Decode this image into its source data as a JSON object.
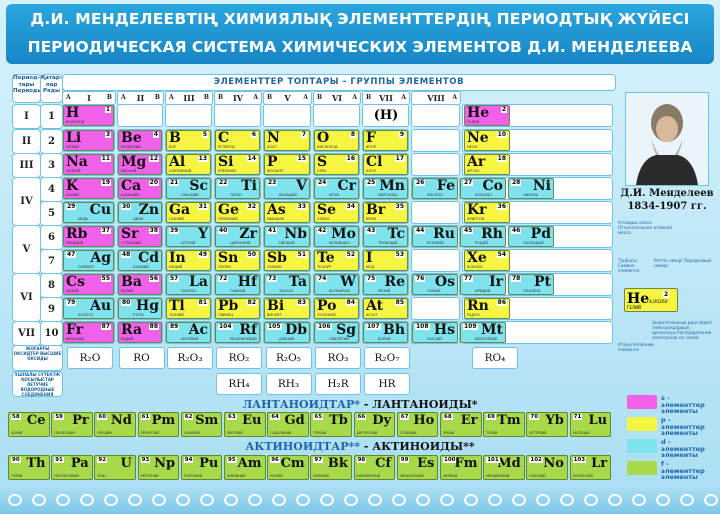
{
  "title": {
    "kz": "Д.И. МЕНДЕЛЕЕВТІҢ ХИМИЯЛЫҚ ЭЛЕМЕНТТЕРДІҢ ПЕРИОДТЫҚ ЖҮЙЕСІ",
    "ru": "ПЕРИОДИЧЕСКАЯ СИСТЕМА ХИМИЧЕСКИХ ЭЛЕМЕНТОВ Д.И. МЕНДЕЛЕЕВА"
  },
  "headers": {
    "periods": "Период-тары Периоды",
    "rows": "Қатар-лар Ряды",
    "groups": "ЭЛЕМЕНТТЕР ТОПТАРЫ  -  ГРУППЫ ЭЛЕМЕНТОВ",
    "oxides": "ЖОҒАРҒЫ ОКСИДТЕР ВЫСШИЕ ОКСИДЫ",
    "hydrides": "ҰШПАЛЫ СУТЕКТІК ҚОСЫЛЫСТАР ЛЕТУЧИЕ ВОДОРОДНЫЕ СОЕДИНЕНИЯ"
  },
  "groups": [
    {
      "a": "A",
      "n": "I",
      "b": "B"
    },
    {
      "a": "A",
      "n": "II",
      "b": "B"
    },
    {
      "a": "A",
      "n": "III",
      "b": "B"
    },
    {
      "a": "B",
      "n": "IV",
      "b": "A"
    },
    {
      "a": "B",
      "n": "V",
      "b": "A"
    },
    {
      "a": "B",
      "n": "VI",
      "b": "A"
    },
    {
      "a": "B",
      "n": "VII",
      "b": "A"
    },
    {
      "a": "",
      "n": "VIII",
      "b": "A"
    }
  ],
  "periods": [
    "I",
    "II",
    "III",
    "IV",
    "V",
    "VI",
    "VII"
  ],
  "rows": [
    "1",
    "2",
    "3",
    "4",
    "5",
    "6",
    "7",
    "8",
    "9",
    "10"
  ],
  "hydrogen_placeholder": "(H)",
  "elements": [
    {
      "s": "H",
      "n": "1",
      "nm": "ВОДОРОД",
      "c": "#f060e8",
      "r": 0,
      "g": 0,
      "al": "l"
    },
    {
      "s": "He",
      "n": "2",
      "nm": "ГЕЛИЙ",
      "c": "#f060e8",
      "r": 0,
      "g": 8,
      "al": "l"
    },
    {
      "s": "Li",
      "n": "3",
      "nm": "ЛИТИЙ",
      "c": "#f060e8",
      "r": 1,
      "g": 0,
      "al": "l"
    },
    {
      "s": "Be",
      "n": "4",
      "nm": "БЕРИЛЛИЙ",
      "c": "#f060e8",
      "r": 1,
      "g": 1,
      "al": "l"
    },
    {
      "s": "B",
      "n": "5",
      "nm": "БОР",
      "c": "#f5f542",
      "r": 1,
      "g": 2,
      "al": "l"
    },
    {
      "s": "C",
      "n": "6",
      "nm": "УГЛЕРОД",
      "c": "#f5f542",
      "r": 1,
      "g": 3,
      "al": "l"
    },
    {
      "s": "N",
      "n": "7",
      "nm": "АЗОТ",
      "c": "#f5f542",
      "r": 1,
      "g": 4,
      "al": "l"
    },
    {
      "s": "O",
      "n": "8",
      "nm": "КИСЛОРОД",
      "c": "#f5f542",
      "r": 1,
      "g": 5,
      "al": "l"
    },
    {
      "s": "F",
      "n": "9",
      "nm": "ФТОР",
      "c": "#f5f542",
      "r": 1,
      "g": 6,
      "al": "l"
    },
    {
      "s": "Ne",
      "n": "10",
      "nm": "НЕОН",
      "c": "#f5f542",
      "r": 1,
      "g": 8,
      "al": "l"
    },
    {
      "s": "Na",
      "n": "11",
      "nm": "НАТРИЙ",
      "c": "#f060e8",
      "r": 2,
      "g": 0,
      "al": "l"
    },
    {
      "s": "Mg",
      "n": "12",
      "nm": "МАГНИЙ",
      "c": "#f060e8",
      "r": 2,
      "g": 1,
      "al": "l"
    },
    {
      "s": "Al",
      "n": "13",
      "nm": "АЛЮМИНИЙ",
      "c": "#f5f542",
      "r": 2,
      "g": 2,
      "al": "l"
    },
    {
      "s": "Si",
      "n": "14",
      "nm": "КРЕМНИЙ",
      "c": "#f5f542",
      "r": 2,
      "g": 3,
      "al": "l"
    },
    {
      "s": "P",
      "n": "15",
      "nm": "ФОСФОР",
      "c": "#f5f542",
      "r": 2,
      "g": 4,
      "al": "l"
    },
    {
      "s": "S",
      "n": "16",
      "nm": "СЕРА",
      "c": "#f5f542",
      "r": 2,
      "g": 5,
      "al": "l"
    },
    {
      "s": "Cl",
      "n": "17",
      "nm": "ХЛОР",
      "c": "#f5f542",
      "r": 2,
      "g": 6,
      "al": "l"
    },
    {
      "s": "Ar",
      "n": "18",
      "nm": "АРГОН",
      "c": "#f5f542",
      "r": 2,
      "g": 8,
      "al": "l"
    },
    {
      "s": "K",
      "n": "19",
      "nm": "КАЛИЙ",
      "c": "#f060e8",
      "r": 3,
      "g": 0,
      "al": "l"
    },
    {
      "s": "Ca",
      "n": "20",
      "nm": "КАЛЬЦИЙ",
      "c": "#f060e8",
      "r": 3,
      "g": 1,
      "al": "l"
    },
    {
      "s": "Sc",
      "n": "21",
      "nm": "СКАНДИЙ",
      "c": "#7fe3ee",
      "r": 3,
      "g": 2,
      "al": "r"
    },
    {
      "s": "Ti",
      "n": "22",
      "nm": "ТИТАН",
      "c": "#7fe3ee",
      "r": 3,
      "g": 3,
      "al": "r"
    },
    {
      "s": "V",
      "n": "23",
      "nm": "ВАНАДИЙ",
      "c": "#7fe3ee",
      "r": 3,
      "g": 4,
      "al": "r"
    },
    {
      "s": "Cr",
      "n": "24",
      "nm": "ХРОМ",
      "c": "#7fe3ee",
      "r": 3,
      "g": 5,
      "al": "r"
    },
    {
      "s": "Mn",
      "n": "25",
      "nm": "МАРГАНЕЦ",
      "c": "#7fe3ee",
      "r": 3,
      "g": 6,
      "al": "r"
    },
    {
      "s": "Fe",
      "n": "26",
      "nm": "ЖЕЛЕЗО",
      "c": "#7fe3ee",
      "r": 3,
      "g": 7,
      "al": "r",
      "x": 0
    },
    {
      "s": "Co",
      "n": "27",
      "nm": "КОБАЛЬТ",
      "c": "#7fe3ee",
      "r": 3,
      "g": 7,
      "al": "r",
      "x": 1
    },
    {
      "s": "Ni",
      "n": "28",
      "nm": "НИКЕЛЬ",
      "c": "#7fe3ee",
      "r": 3,
      "g": 7,
      "al": "r",
      "x": 2
    },
    {
      "s": "Cu",
      "n": "29",
      "nm": "МЕДЬ",
      "c": "#7fe3ee",
      "r": 4,
      "g": 0,
      "al": "r"
    },
    {
      "s": "Zn",
      "n": "30",
      "nm": "ЦИНК",
      "c": "#7fe3ee",
      "r": 4,
      "g": 1,
      "al": "r"
    },
    {
      "s": "Ga",
      "n": "31",
      "nm": "ГАЛЛИЙ",
      "c": "#f5f542",
      "r": 4,
      "g": 2,
      "al": "l"
    },
    {
      "s": "Ge",
      "n": "32",
      "nm": "ГЕРМАНИЙ",
      "c": "#f5f542",
      "r": 4,
      "g": 3,
      "al": "l"
    },
    {
      "s": "As",
      "n": "33",
      "nm": "МЫШЬЯК",
      "c": "#f5f542",
      "r": 4,
      "g": 4,
      "al": "l"
    },
    {
      "s": "Se",
      "n": "34",
      "nm": "СЕЛЕН",
      "c": "#f5f542",
      "r": 4,
      "g": 5,
      "al": "l"
    },
    {
      "s": "Br",
      "n": "35",
      "nm": "БРОМ",
      "c": "#f5f542",
      "r": 4,
      "g": 6,
      "al": "l"
    },
    {
      "s": "Kr",
      "n": "36",
      "nm": "КРИПТОН",
      "c": "#f5f542",
      "r": 4,
      "g": 8,
      "al": "l"
    },
    {
      "s": "Rb",
      "n": "37",
      "nm": "РУБИДИЙ",
      "c": "#f060e8",
      "r": 5,
      "g": 0,
      "al": "l"
    },
    {
      "s": "Sr",
      "n": "38",
      "nm": "СТРОНЦИЙ",
      "c": "#f060e8",
      "r": 5,
      "g": 1,
      "al": "l"
    },
    {
      "s": "Y",
      "n": "39",
      "nm": "ИТТРИЙ",
      "c": "#7fe3ee",
      "r": 5,
      "g": 2,
      "al": "r"
    },
    {
      "s": "Zr",
      "n": "40",
      "nm": "ЦИРКОНИЙ",
      "c": "#7fe3ee",
      "r": 5,
      "g": 3,
      "al": "r"
    },
    {
      "s": "Nb",
      "n": "41",
      "nm": "НИОБИЙ",
      "c": "#7fe3ee",
      "r": 5,
      "g": 4,
      "al": "r"
    },
    {
      "s": "Mo",
      "n": "42",
      "nm": "МОЛИБДЕН",
      "c": "#7fe3ee",
      "r": 5,
      "g": 5,
      "al": "r"
    },
    {
      "s": "Tc",
      "n": "43",
      "nm": "ТЕХНЕЦИЙ",
      "c": "#7fe3ee",
      "r": 5,
      "g": 6,
      "al": "r"
    },
    {
      "s": "Ru",
      "n": "44",
      "nm": "РУТЕНИЙ",
      "c": "#7fe3ee",
      "r": 5,
      "g": 7,
      "al": "r",
      "x": 0
    },
    {
      "s": "Rh",
      "n": "45",
      "nm": "РОДИЙ",
      "c": "#7fe3ee",
      "r": 5,
      "g": 7,
      "al": "r",
      "x": 1
    },
    {
      "s": "Pd",
      "n": "46",
      "nm": "ПАЛЛАДИЙ",
      "c": "#7fe3ee",
      "r": 5,
      "g": 7,
      "al": "r",
      "x": 2
    },
    {
      "s": "Ag",
      "n": "47",
      "nm": "СЕРЕБРО",
      "c": "#7fe3ee",
      "r": 6,
      "g": 0,
      "al": "r"
    },
    {
      "s": "Cd",
      "n": "48",
      "nm": "КАДМИЙ",
      "c": "#7fe3ee",
      "r": 6,
      "g": 1,
      "al": "r"
    },
    {
      "s": "In",
      "n": "49",
      "nm": "ИНДИЙ",
      "c": "#f5f542",
      "r": 6,
      "g": 2,
      "al": "l"
    },
    {
      "s": "Sn",
      "n": "50",
      "nm": "ОЛОВО",
      "c": "#f5f542",
      "r": 6,
      "g": 3,
      "al": "l"
    },
    {
      "s": "Sb",
      "n": "51",
      "nm": "СУРЬМА",
      "c": "#f5f542",
      "r": 6,
      "g": 4,
      "al": "l"
    },
    {
      "s": "Te",
      "n": "52",
      "nm": "ТЕЛЛУР",
      "c": "#f5f542",
      "r": 6,
      "g": 5,
      "al": "l"
    },
    {
      "s": "I",
      "n": "53",
      "nm": "ИОД",
      "c": "#f5f542",
      "r": 6,
      "g": 6,
      "al": "l"
    },
    {
      "s": "Xe",
      "n": "54",
      "nm": "КСЕНОН",
      "c": "#f5f542",
      "r": 6,
      "g": 8,
      "al": "l"
    },
    {
      "s": "Cs",
      "n": "55",
      "nm": "ЦЕЗИЙ",
      "c": "#f060e8",
      "r": 7,
      "g": 0,
      "al": "l"
    },
    {
      "s": "Ba",
      "n": "56",
      "nm": "БАРИЙ",
      "c": "#f060e8",
      "r": 7,
      "g": 1,
      "al": "l"
    },
    {
      "s": "La",
      "n": "57",
      "nm": "ЛАНТАН",
      "c": "#7fe3ee",
      "r": 7,
      "g": 2,
      "al": "r"
    },
    {
      "s": "Hf",
      "n": "72",
      "nm": "ГАФНИЙ",
      "c": "#7fe3ee",
      "r": 7,
      "g": 3,
      "al": "r"
    },
    {
      "s": "Ta",
      "n": "73",
      "nm": "ТАНТАЛ",
      "c": "#7fe3ee",
      "r": 7,
      "g": 4,
      "al": "r"
    },
    {
      "s": "W",
      "n": "74",
      "nm": "ВОЛЬФРАМ",
      "c": "#7fe3ee",
      "r": 7,
      "g": 5,
      "al": "r"
    },
    {
      "s": "Re",
      "n": "75",
      "nm": "РЕНИЙ",
      "c": "#7fe3ee",
      "r": 7,
      "g": 6,
      "al": "r"
    },
    {
      "s": "Os",
      "n": "76",
      "nm": "ОСМИЙ",
      "c": "#7fe3ee",
      "r": 7,
      "g": 7,
      "al": "r",
      "x": 0
    },
    {
      "s": "Ir",
      "n": "77",
      "nm": "ИРИДИЙ",
      "c": "#7fe3ee",
      "r": 7,
      "g": 7,
      "al": "r",
      "x": 1
    },
    {
      "s": "Pt",
      "n": "78",
      "nm": "ПЛАТИНА",
      "c": "#7fe3ee",
      "r": 7,
      "g": 7,
      "al": "r",
      "x": 2
    },
    {
      "s": "Au",
      "n": "79",
      "nm": "ЗОЛОТО",
      "c": "#7fe3ee",
      "r": 8,
      "g": 0,
      "al": "r"
    },
    {
      "s": "Hg",
      "n": "80",
      "nm": "РТУТЬ",
      "c": "#7fe3ee",
      "r": 8,
      "g": 1,
      "al": "r"
    },
    {
      "s": "Tl",
      "n": "81",
      "nm": "ТАЛЛИЙ",
      "c": "#f5f542",
      "r": 8,
      "g": 2,
      "al": "l"
    },
    {
      "s": "Pb",
      "n": "82",
      "nm": "СВИНЕЦ",
      "c": "#f5f542",
      "r": 8,
      "g": 3,
      "al": "l"
    },
    {
      "s": "Bi",
      "n": "83",
      "nm": "ВИСМУТ",
      "c": "#f5f542",
      "r": 8,
      "g": 4,
      "al": "l"
    },
    {
      "s": "Po",
      "n": "84",
      "nm": "ПОЛОНИЙ",
      "c": "#f5f542",
      "r": 8,
      "g": 5,
      "al": "l"
    },
    {
      "s": "At",
      "n": "85",
      "nm": "АСТАТ",
      "c": "#f5f542",
      "r": 8,
      "g": 6,
      "al": "l"
    },
    {
      "s": "Rn",
      "n": "86",
      "nm": "РАДОН",
      "c": "#f5f542",
      "r": 8,
      "g": 8,
      "al": "l"
    },
    {
      "s": "Fr",
      "n": "87",
      "nm": "ФРАНЦИЙ",
      "c": "#f060e8",
      "r": 9,
      "g": 0,
      "al": "l"
    },
    {
      "s": "Ra",
      "n": "88",
      "nm": "РАДИЙ",
      "c": "#f060e8",
      "r": 9,
      "g": 1,
      "al": "l"
    },
    {
      "s": "Ac",
      "n": "89",
      "nm": "АКТИНИЙ",
      "c": "#7fe3ee",
      "r": 9,
      "g": 2,
      "al": "r"
    },
    {
      "s": "Rf",
      "n": "104",
      "nm": "РЕЗЕРФОРДИЙ",
      "c": "#7fe3ee",
      "r": 9,
      "g": 3,
      "al": "r"
    },
    {
      "s": "Db",
      "n": "105",
      "nm": "ДУБНИЙ",
      "c": "#7fe3ee",
      "r": 9,
      "g": 4,
      "al": "r"
    },
    {
      "s": "Sg",
      "n": "106",
      "nm": "СИБОРГИЙ",
      "c": "#7fe3ee",
      "r": 9,
      "g": 5,
      "al": "r"
    },
    {
      "s": "Bh",
      "n": "107",
      "nm": "БОРИЙ",
      "c": "#7fe3ee",
      "r": 9,
      "g": 6,
      "al": "r"
    },
    {
      "s": "Hs",
      "n": "108",
      "nm": "ХАССИЙ",
      "c": "#7fe3ee",
      "r": 9,
      "g": 7,
      "al": "r",
      "x": 0
    },
    {
      "s": "Mt",
      "n": "109",
      "nm": "МЕЙТНЕРИЙ",
      "c": "#7fe3ee",
      "r": 9,
      "g": 7,
      "al": "r",
      "x": 1
    }
  ],
  "oxides": [
    "R₂O",
    "RO",
    "R₂O₃",
    "RO₂",
    "R₂O₅",
    "RO₃",
    "R₂O₇",
    "RO₄"
  ],
  "hydrides": [
    "RH₄",
    "RH₃",
    "H₂R",
    "HR"
  ],
  "lanthanides_title": {
    "kz": "ЛАНТАНОИДТАР*",
    "ru": " - ЛАНТАНОИДЫ*"
  },
  "actinides_title": {
    "kz": "АКТИНОИДТАР**",
    "ru": " - АКТИНОИДЫ**"
  },
  "lanthanides": [
    {
      "s": "Ce",
      "n": "58",
      "nm": "ЦЕРИЙ"
    },
    {
      "s": "Pr",
      "n": "59",
      "nm": "ПРАЗЕОДИМ"
    },
    {
      "s": "Nd",
      "n": "60",
      "nm": "НЕОДИМ"
    },
    {
      "s": "Pm",
      "n": "61",
      "nm": "ПРОМЕТИЙ"
    },
    {
      "s": "Sm",
      "n": "62",
      "nm": "САМАРИЙ"
    },
    {
      "s": "Eu",
      "n": "63",
      "nm": "ЕВРОПИЙ"
    },
    {
      "s": "Gd",
      "n": "64",
      "nm": "ГАДОЛИНИЙ"
    },
    {
      "s": "Tb",
      "n": "65",
      "nm": "ТЕРБИЙ"
    },
    {
      "s": "Dy",
      "n": "66",
      "nm": "ДИСПРОЗИЙ"
    },
    {
      "s": "Ho",
      "n": "67",
      "nm": "ГОЛЬМИЙ"
    },
    {
      "s": "Er",
      "n": "68",
      "nm": "ЭРБИЙ"
    },
    {
      "s": "Tm",
      "n": "69",
      "nm": "ТУЛИЙ"
    },
    {
      "s": "Yb",
      "n": "70",
      "nm": "ИТТЕРБИЙ"
    },
    {
      "s": "Lu",
      "n": "71",
      "nm": "ЛЮТЕЦИЙ"
    }
  ],
  "actinides": [
    {
      "s": "Th",
      "n": "90",
      "nm": "ТОРИЙ"
    },
    {
      "s": "Pa",
      "n": "91",
      "nm": "ПРОТАКТИНИЙ"
    },
    {
      "s": "U",
      "n": "92",
      "nm": "УРАН"
    },
    {
      "s": "Np",
      "n": "93",
      "nm": "НЕПТУНИЙ"
    },
    {
      "s": "Pu",
      "n": "94",
      "nm": "ПЛУТОНИЙ"
    },
    {
      "s": "Am",
      "n": "95",
      "nm": "АМЕРИЦИЙ"
    },
    {
      "s": "Cm",
      "n": "96",
      "nm": "КЮРИЙ"
    },
    {
      "s": "Bk",
      "n": "97",
      "nm": "БЕРКЛИЙ"
    },
    {
      "s": "Cf",
      "n": "98",
      "nm": "КАЛИФОРНИЙ"
    },
    {
      "s": "Es",
      "n": "99",
      "nm": "ЭЙНШТЕЙНИЙ"
    },
    {
      "s": "Fm",
      "n": "100",
      "nm": "ФЕРМИЙ"
    },
    {
      "s": "Md",
      "n": "101",
      "nm": "МЕНДЕЛЕВИЙ"
    },
    {
      "s": "No",
      "n": "102",
      "nm": "НОБЕЛИЙ"
    },
    {
      "s": "Lr",
      "n": "103",
      "nm": "ЛОУРЕНСИЙ"
    }
  ],
  "portrait": {
    "name": "Д.И. Менделеев",
    "years": "1834-1907 гг."
  },
  "key": {
    "atomic_mass": "Атомдық масса Относительная атомная масса",
    "symbol": "Таңбасы Символ элемента",
    "ordinal": "Реттік нөмірі Порядковый номер",
    "electrons": "Энергетикалық деңгейдегі электрондардың орналасуы Распределение электронов по слоям",
    "name": "Атауы Название элемента",
    "example_symbol": "He",
    "example_number": "2",
    "example_mass": "4,00260",
    "example_name": "ГЕЛИЙ"
  },
  "legend": [
    {
      "label": "s - элементтер элементы",
      "color": "#f060e8",
      "prefix": "s"
    },
    {
      "label": "p - элементтер элементы",
      "color": "#f5f542",
      "prefix": "p"
    },
    {
      "label": "d - элементтер элементы",
      "color": "#7fe3ee",
      "prefix": "d"
    },
    {
      "label": "f - элементтер элементы",
      "color": "#a8d94a",
      "prefix": "f"
    }
  ]
}
